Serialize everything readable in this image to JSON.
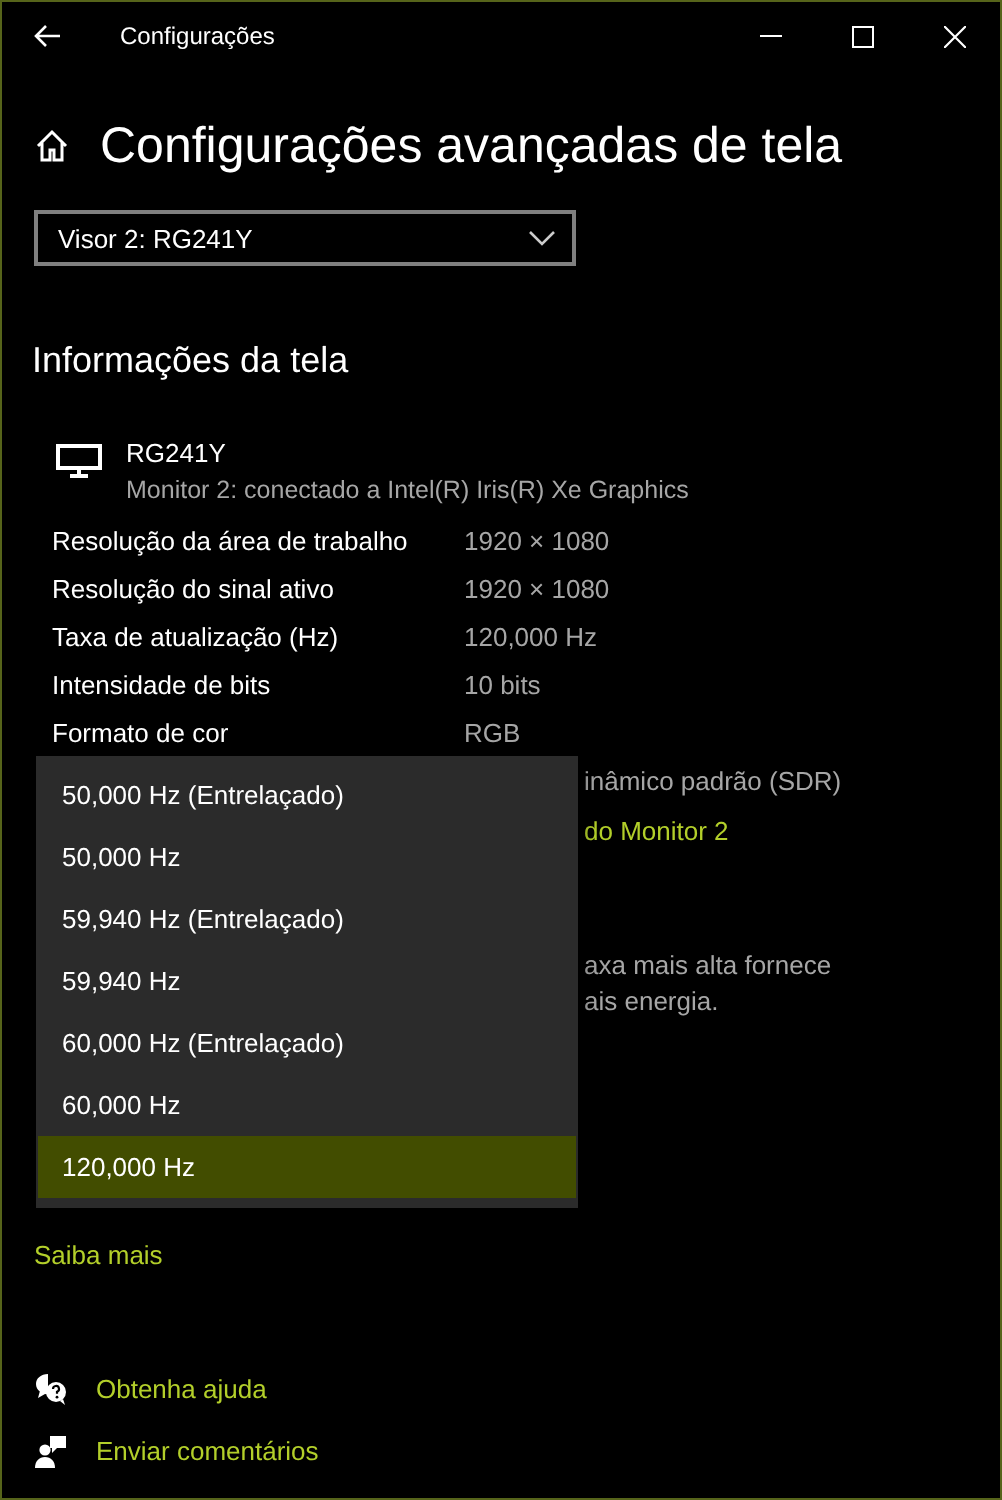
{
  "window": {
    "title": "Configurações"
  },
  "page_title": "Configurações avançadas de tela",
  "display_select": {
    "value": "Visor 2: RG241Y"
  },
  "section_title": "Informações da tela",
  "monitor": {
    "name": "RG241Y",
    "description": "Monitor 2: conectado a Intel(R) Iris(R) Xe Graphics"
  },
  "info_rows": [
    {
      "label": "Resolução da área de trabalho",
      "value": "1920 × 1080"
    },
    {
      "label": "Resolução do sinal ativo",
      "value": "1920 × 1080"
    },
    {
      "label": "Taxa de atualização (Hz)",
      "value": "120,000 Hz"
    },
    {
      "label": "Intensidade de bits",
      "value": "10 bits"
    },
    {
      "label": "Formato de cor",
      "value": "RGB"
    }
  ],
  "partial_texts": [
    {
      "text": "inâmico padrão (SDR)",
      "kind": "text"
    },
    {
      "text": "do Monitor 2",
      "kind": "link"
    },
    {
      "text": "axa mais alta fornece",
      "kind": "paragraph"
    },
    {
      "text": "ais energia.",
      "kind": "paragraph"
    }
  ],
  "learn_more_link": "Saiba mais",
  "refresh_rate_menu": {
    "options": [
      {
        "label": "50,000 Hz (Entrelaçado)",
        "selected": false
      },
      {
        "label": "50,000 Hz",
        "selected": false
      },
      {
        "label": "59,940 Hz (Entrelaçado)",
        "selected": false
      },
      {
        "label": "59,940 Hz",
        "selected": false
      },
      {
        "label": "60,000 Hz (Entrelaçado)",
        "selected": false
      },
      {
        "label": "60,000 Hz",
        "selected": false
      },
      {
        "label": "120,000 Hz",
        "selected": true
      }
    ]
  },
  "footer_links": [
    {
      "label": "Obtenha ajuda",
      "kind": "help"
    },
    {
      "label": "Enviar comentários",
      "kind": "feedback"
    }
  ]
}
